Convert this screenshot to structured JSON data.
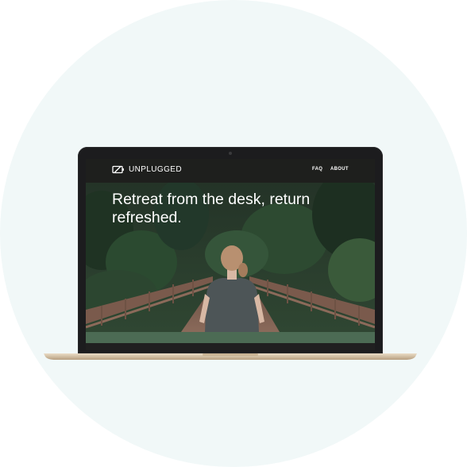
{
  "site": {
    "brand": "UNPLUGGED",
    "logo_icon": "battery-slash-icon"
  },
  "nav": {
    "items": [
      {
        "label": "FAQ"
      },
      {
        "label": "ABOUT"
      }
    ]
  },
  "hero": {
    "headline": "Retreat from the desk, return refreshed.",
    "image": "woman-on-forest-bridge"
  },
  "colors": {
    "page_background": "#ffffff",
    "backdrop_circle": "#f1f8f8",
    "navbar": "#1e1f1d",
    "footer_band": "#4c6b54",
    "laptop_lid": "#1c1c1e",
    "laptop_base": "#d8c3a5"
  }
}
